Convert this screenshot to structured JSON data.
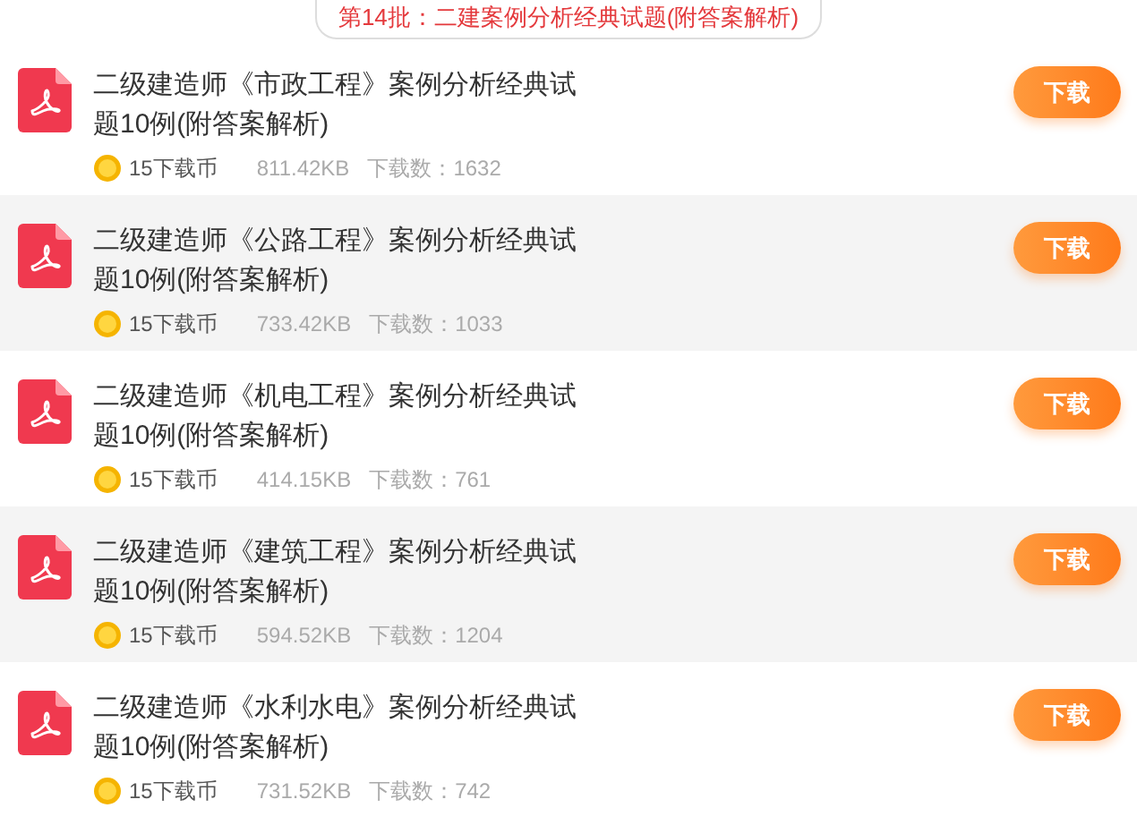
{
  "batch_title": "第14批：二建案例分析经典试题(附答案解析)",
  "items": [
    {
      "title": "二级建造师《市政工程》案例分析经典试题10例(附答案解析)",
      "coins": "15下载币",
      "size": "811.42KB",
      "downloads": "下载数：1632",
      "button": "下载"
    },
    {
      "title": "二级建造师《公路工程》案例分析经典试题10例(附答案解析)",
      "coins": "15下载币",
      "size": "733.42KB",
      "downloads": "下载数：1033",
      "button": "下载"
    },
    {
      "title": "二级建造师《机电工程》案例分析经典试题10例(附答案解析)",
      "coins": "15下载币",
      "size": "414.15KB",
      "downloads": "下载数：761",
      "button": "下载"
    },
    {
      "title": "二级建造师《建筑工程》案例分析经典试题10例(附答案解析)",
      "coins": "15下载币",
      "size": "594.52KB",
      "downloads": "下载数：1204",
      "button": "下载"
    },
    {
      "title": "二级建造师《水利水电》案例分析经典试题10例(附答案解析)",
      "coins": "15下载币",
      "size": "731.52KB",
      "downloads": "下载数：742",
      "button": "下载"
    }
  ]
}
